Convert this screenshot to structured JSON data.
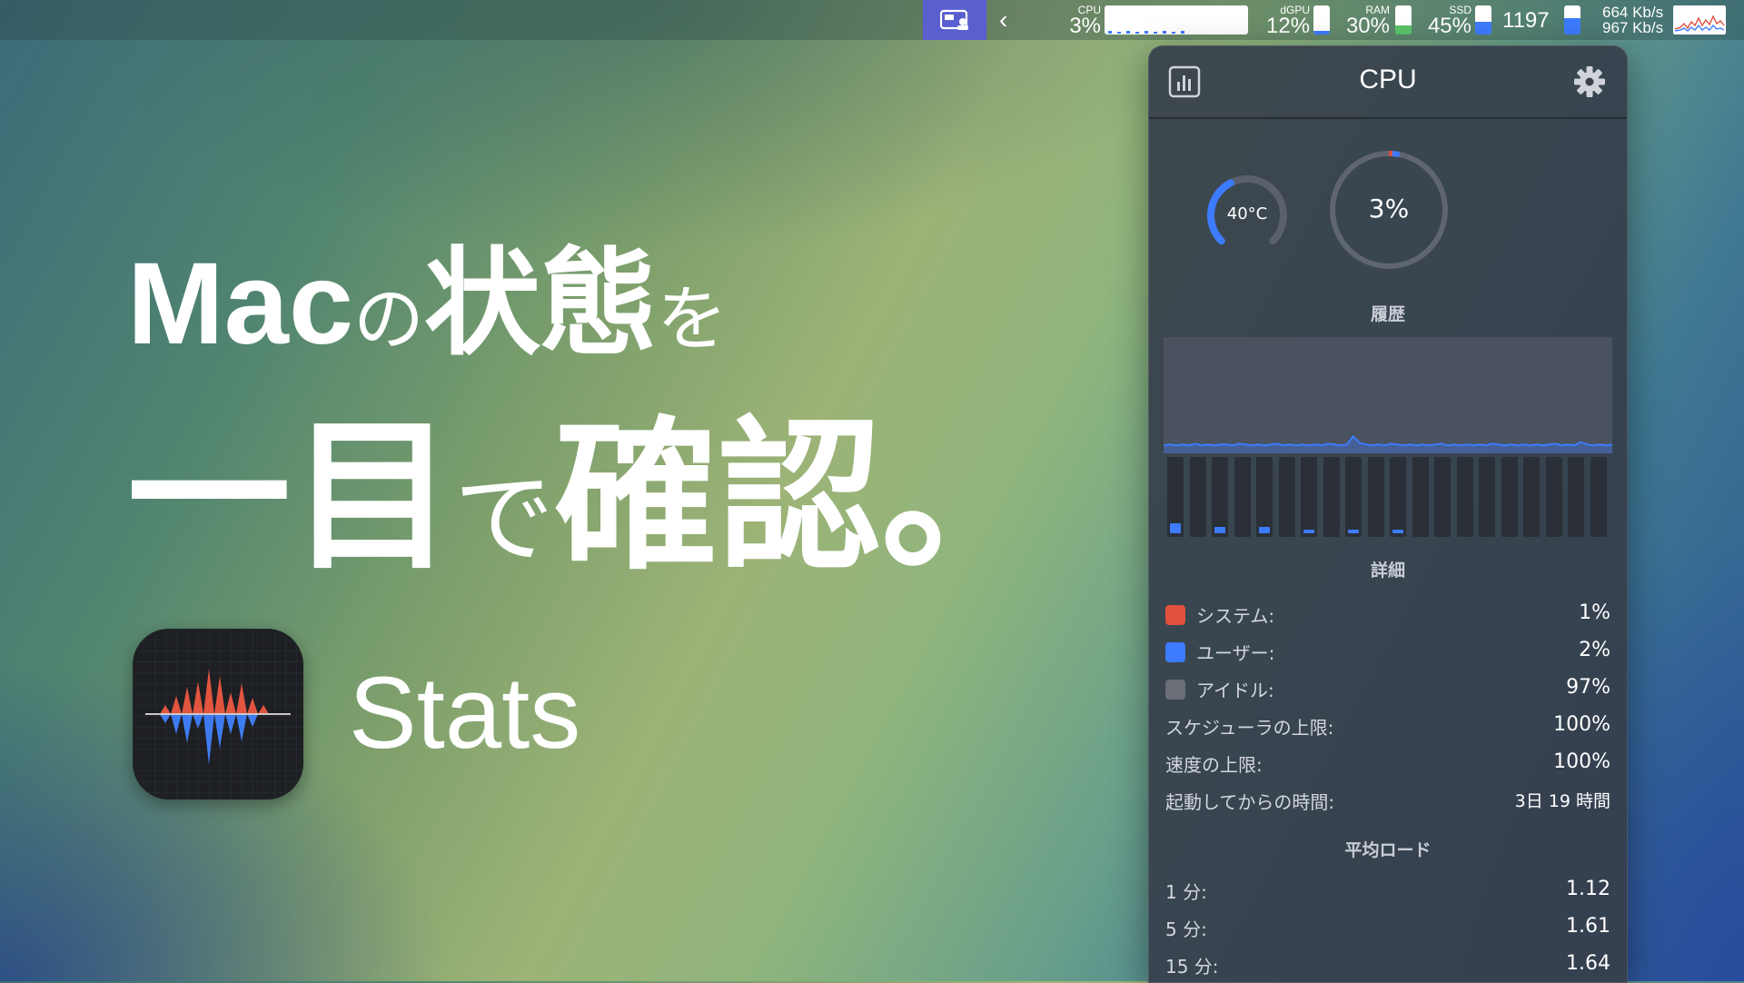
{
  "menubar": {
    "cpu": {
      "label": "CPU",
      "value": "3%"
    },
    "dgpu": {
      "label": "dGPU",
      "value": "12%",
      "fill": 0.12
    },
    "ram": {
      "label": "RAM",
      "value": "30%",
      "fill": 0.3
    },
    "ssd": {
      "label": "SSD",
      "value": "45%",
      "fill": 0.45
    },
    "sensor": {
      "value": "1197",
      "fill": 0.55
    },
    "network": {
      "upload": "664 Kb/s",
      "download": "967 Kb/s"
    },
    "colors": {
      "app_bg": "#5a5fd0",
      "ram_fill": "#5ac46a",
      "blue_fill": "#3d7bff"
    }
  },
  "hero": {
    "line1": {
      "mac": "Mac",
      "no": "の",
      "jotai": "状態",
      "wo": "を"
    },
    "line2": {
      "ichimoku": "一目",
      "de": "で",
      "kakunin": "確認。"
    },
    "app_name": "Stats"
  },
  "panel": {
    "title": "CPU",
    "temperature": {
      "value": "40°C",
      "level": 0.4
    },
    "usage": {
      "value": "3%",
      "system": 0.01,
      "user": 0.02
    },
    "history_title": "履歴",
    "history": [
      0.02,
      0.03,
      0.02,
      0.03,
      0.02,
      0.04,
      0.02,
      0.03,
      0.02,
      0.03,
      0.03,
      0.02,
      0.04,
      0.03,
      0.02,
      0.03,
      0.02,
      0.03,
      0.04,
      0.02,
      0.03,
      0.02,
      0.03,
      0.02,
      0.03,
      0.02,
      0.04,
      0.03,
      0.02,
      0.03,
      0.13,
      0.05,
      0.03,
      0.02,
      0.03,
      0.02,
      0.04,
      0.03,
      0.02,
      0.03,
      0.02,
      0.03,
      0.02,
      0.03,
      0.04,
      0.02,
      0.03,
      0.02,
      0.03,
      0.02,
      0.03,
      0.02,
      0.04,
      0.03,
      0.02,
      0.03,
      0.02,
      0.03,
      0.02,
      0.03,
      0.02,
      0.03,
      0.04,
      0.02,
      0.03,
      0.02,
      0.06,
      0.03,
      0.02,
      0.03,
      0.02,
      0.03
    ],
    "cores": [
      0.12,
      0.0,
      0.08,
      0.0,
      0.08,
      0.0,
      0.04,
      0.0,
      0.04,
      0.0,
      0.04,
      0.0,
      0.0,
      0.0,
      0.0,
      0.0,
      0.0,
      0.0,
      0.0,
      0.0
    ],
    "details_title": "詳細",
    "details": [
      {
        "label": "システム:",
        "value": "1%",
        "color": "#e0503c"
      },
      {
        "label": "ユーザー:",
        "value": "2%",
        "color": "#3d7bff"
      },
      {
        "label": "アイドル:",
        "value": "97%",
        "color": "#6a6f78"
      }
    ],
    "limits": [
      {
        "label": "スケジューラの上限:",
        "value": "100%"
      },
      {
        "label": "速度の上限:",
        "value": "100%"
      },
      {
        "label": "起動してからの時間:",
        "value": "3日 19 時間"
      }
    ],
    "load_title": "平均ロード",
    "load": [
      {
        "label": "1 分:",
        "value": "1.12"
      },
      {
        "label": "5 分:",
        "value": "1.61"
      },
      {
        "label": "15 分:",
        "value": "1.64"
      }
    ]
  }
}
